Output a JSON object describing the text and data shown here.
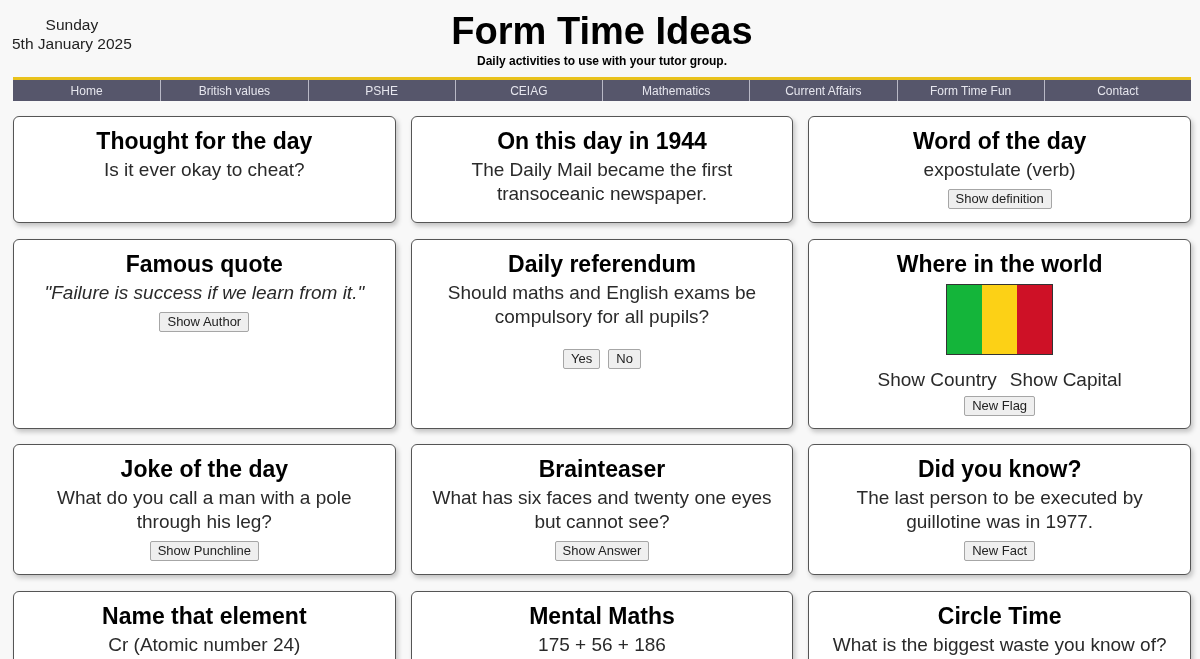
{
  "header": {
    "day": "Sunday",
    "date": "5th January 2025",
    "title": "Form Time Ideas",
    "subtitle": "Daily activities to use with your tutor group."
  },
  "nav": {
    "items": [
      {
        "label": "Home"
      },
      {
        "label": "British values"
      },
      {
        "label": "PSHE"
      },
      {
        "label": "CEIAG"
      },
      {
        "label": "Mathematics"
      },
      {
        "label": "Current Affairs"
      },
      {
        "label": "Form Time Fun"
      },
      {
        "label": "Contact"
      }
    ]
  },
  "cards": [
    {
      "kind": "text",
      "title": "Thought for the day",
      "text": "Is it ever okay to cheat?"
    },
    {
      "kind": "text",
      "title": "On this day in 1944",
      "text": "The Daily Mail became the first transoceanic newspaper."
    },
    {
      "kind": "text",
      "title": "Word of the day",
      "text": "expostulate (verb)",
      "buttons": [
        "Show definition"
      ]
    },
    {
      "kind": "quote",
      "title": "Famous quote",
      "text": "\"Failure is success if we learn from it.\"",
      "buttons": [
        "Show Author"
      ]
    },
    {
      "kind": "poll",
      "title": "Daily referendum",
      "text": "Should maths and English exams be compulsory for all pupils?",
      "buttons": [
        "Yes",
        "No"
      ]
    },
    {
      "kind": "flag",
      "title": "Where in the world",
      "flag": {
        "stripes": [
          {
            "color": "#14b53a"
          },
          {
            "color": "#fcd116"
          },
          {
            "color": "#ce1126"
          }
        ]
      },
      "links": [
        "Show Country",
        "Show Capital"
      ],
      "buttons": [
        "New Flag"
      ]
    },
    {
      "kind": "text",
      "title": "Joke of the day",
      "text": "What do you call a man with a pole through his leg?",
      "buttons": [
        "Show Punchline"
      ]
    },
    {
      "kind": "text",
      "title": "Brainteaser",
      "text": "What has six faces and twenty one eyes but cannot see?",
      "buttons": [
        "Show Answer"
      ]
    },
    {
      "kind": "text",
      "title": "Did you know?",
      "text": "The last person to be executed by guillotine was in 1977.",
      "buttons": [
        "New Fact"
      ]
    },
    {
      "kind": "text",
      "title": "Name that element",
      "text": "Cr (Atomic number 24)"
    },
    {
      "kind": "text",
      "title": "Mental Maths",
      "text": "175 + 56 + 186"
    },
    {
      "kind": "text",
      "title": "Circle Time",
      "text": "What is the biggest waste you know of?"
    }
  ]
}
